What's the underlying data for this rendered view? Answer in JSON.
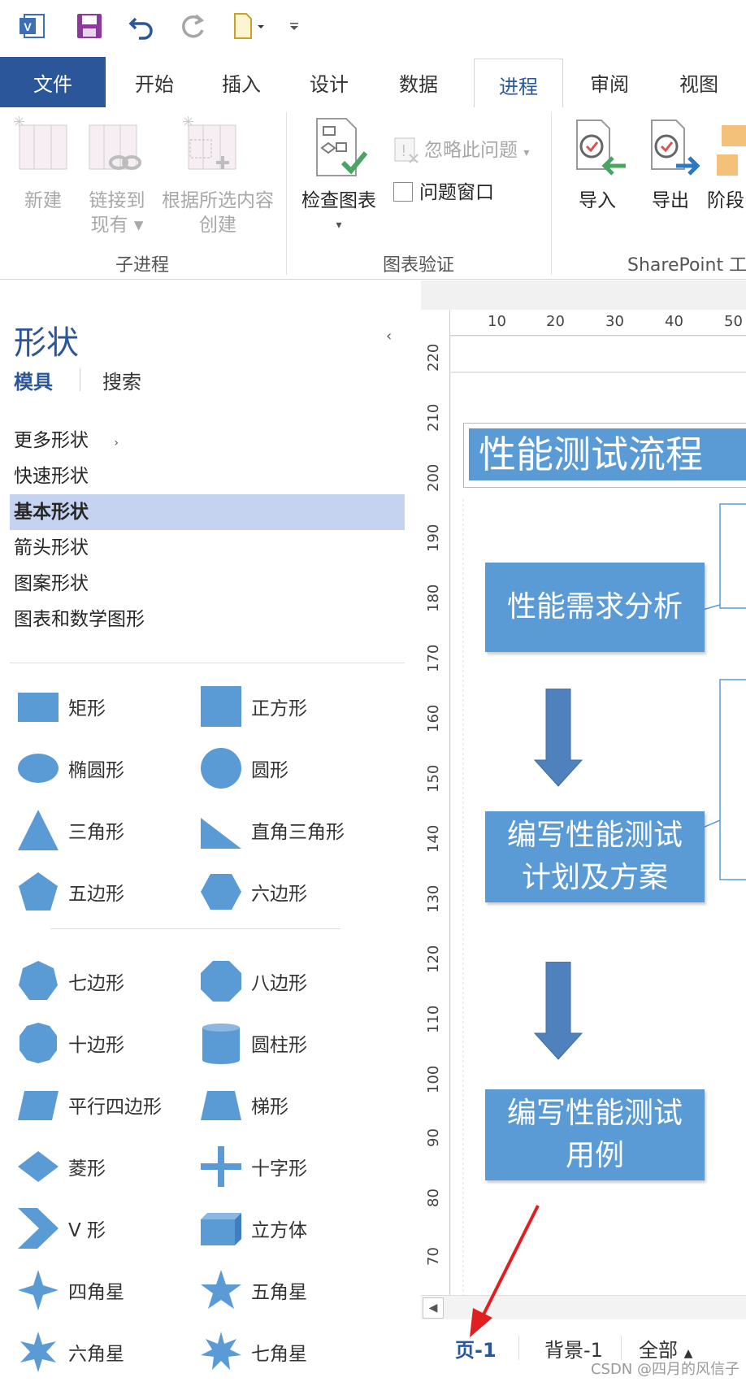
{
  "ribbon_tabs": [
    "文件",
    "开始",
    "插入",
    "设计",
    "数据",
    "进程",
    "审阅",
    "视图"
  ],
  "ribbon": {
    "new_label": "新建",
    "link_label_1": "链接到",
    "link_label_2": "现有",
    "create_label_1": "根据所选内容",
    "create_label_2": "创建",
    "subprocess_group": "子进程",
    "check_diagram_label": "检查图表",
    "ignore_issue_label": "忽略此问题",
    "issues_window_label": "问题窗口",
    "validation_group": "图表验证",
    "import_label": "导入",
    "export_label": "导出",
    "phase_label": "阶段",
    "sharepoint_group": "SharePoint 工"
  },
  "shapes_panel": {
    "title": "形状",
    "tab_stencils": "模具",
    "tab_search": "搜索",
    "menu": [
      "更多形状",
      "快速形状",
      "基本形状",
      "箭头形状",
      "图案形状",
      "图表和数学图形"
    ],
    "shapes": [
      "矩形",
      "正方形",
      "椭圆形",
      "圆形",
      "三角形",
      "直角三角形",
      "五边形",
      "六边形",
      "七边形",
      "八边形",
      "十边形",
      "圆柱形",
      "平行四边形",
      "梯形",
      "菱形",
      "十字形",
      "V 形",
      "立方体",
      "四角星",
      "五角星",
      "六角星",
      "七角星"
    ]
  },
  "canvas": {
    "ruler_h": [
      "10",
      "20",
      "30",
      "40",
      "50"
    ],
    "ruler_v": [
      "220",
      "210",
      "200",
      "190",
      "180",
      "170",
      "160",
      "150",
      "140",
      "130",
      "120",
      "110",
      "100",
      "90",
      "80",
      "70"
    ],
    "title": "性能测试流程",
    "box1": "性能需求分析",
    "box2_line1": "编写性能测试",
    "box2_line2": "计划及方案",
    "box3_line1": "编写性能测试",
    "box3_line2": "用例"
  },
  "page_tabs": [
    "页-1",
    "背景-1",
    "全部"
  ],
  "watermark": "CSDN @四月的风信子",
  "colors": {
    "accent": "#2b579a",
    "shape": "#5b9bd5",
    "arrow": "#4f81bd"
  }
}
